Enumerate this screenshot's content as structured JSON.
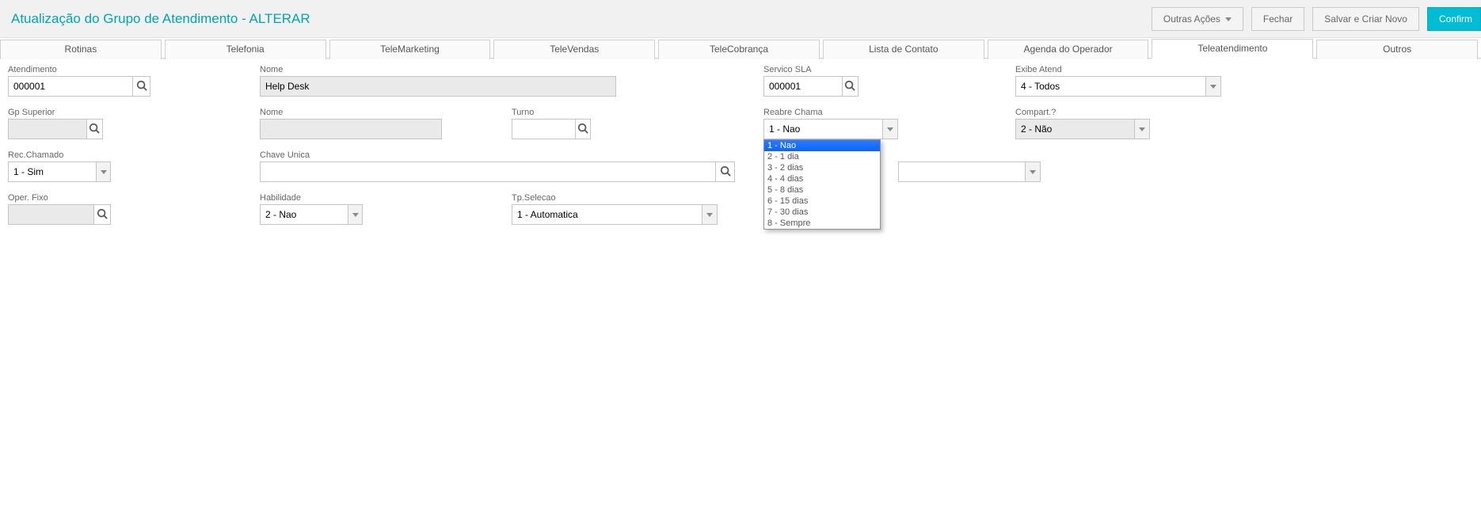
{
  "header": {
    "title": "Atualização do Grupo de Atendimento - ALTERAR",
    "actions": {
      "other": "Outras Ações",
      "close": "Fechar",
      "save_new": "Salvar e Criar Novo",
      "confirm": "Confirm"
    }
  },
  "tabs": [
    "Rotinas",
    "Telefonia",
    "TeleMarketing",
    "TeleVendas",
    "TeleCobrança",
    "Lista de Contato",
    "Agenda do Operador",
    "Teleatendimento",
    "Outros"
  ],
  "active_tab_index": 7,
  "fields": {
    "atendimento": {
      "label": "Atendimento",
      "value": "000001"
    },
    "nome1": {
      "label": "Nome",
      "value": "Help Desk"
    },
    "servico_sla": {
      "label": "Servico SLA",
      "value": "000001"
    },
    "exibe_atend": {
      "label": "Exibe Atend",
      "value": "4 - Todos"
    },
    "gp_superior": {
      "label": "Gp Superior",
      "value": ""
    },
    "nome2": {
      "label": "Nome",
      "value": ""
    },
    "turno": {
      "label": "Turno",
      "value": ""
    },
    "reabre": {
      "label": "Reabre Chama",
      "value": "1 - Nao",
      "options": [
        "1 - Nao",
        "2 - 1 dia",
        "3 - 2 dias",
        "4 - 4 dias",
        "5 - 8 dias",
        "6 - 15 dias",
        "7 - 30 dias",
        "8 - Sempre"
      ]
    },
    "compart": {
      "label": "Compart.?",
      "value": "2 - Não"
    },
    "rec_chamado": {
      "label": "Rec.Chamado",
      "value": "1 - Sim"
    },
    "chave_unica": {
      "label": "Chave Unica",
      "value": ""
    },
    "extra_combo": {
      "value": ""
    },
    "oper_fixo": {
      "label": "Oper. Fixo",
      "value": ""
    },
    "habilidade": {
      "label": "Habilidade",
      "value": "2 - Nao"
    },
    "tp_selecao": {
      "label": "Tp.Selecao",
      "value": "1 - Automatica"
    }
  }
}
